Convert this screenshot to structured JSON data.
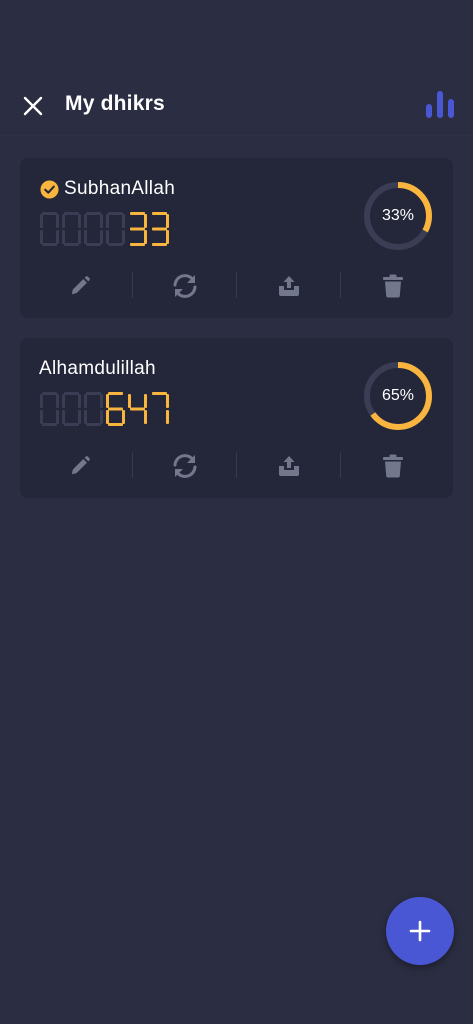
{
  "header": {
    "title": "My dhikrs",
    "close_icon": "close-icon",
    "stats_icon": "bar-chart-icon"
  },
  "dhikrs": [
    {
      "name": "SubhanAllah",
      "selected": true,
      "counter_display": "000033",
      "count": 33,
      "progress_percent": 33,
      "progress_label": "33%"
    },
    {
      "name": "Alhamdulillah",
      "selected": false,
      "counter_display": "000647",
      "count": 647,
      "progress_percent": 65,
      "progress_label": "65%"
    }
  ],
  "card_actions": [
    "pencil-icon",
    "refresh-icon",
    "share-icon",
    "trash-icon"
  ],
  "fab": {
    "icon": "plus-icon"
  },
  "colors": {
    "background": "#2b2d42",
    "card": "#24263a",
    "accent": "#f9b53d",
    "digit_off": "#3a3d54",
    "icon": "#73778c",
    "ring_track": "#3a3d54",
    "primary": "#4a57d4"
  }
}
